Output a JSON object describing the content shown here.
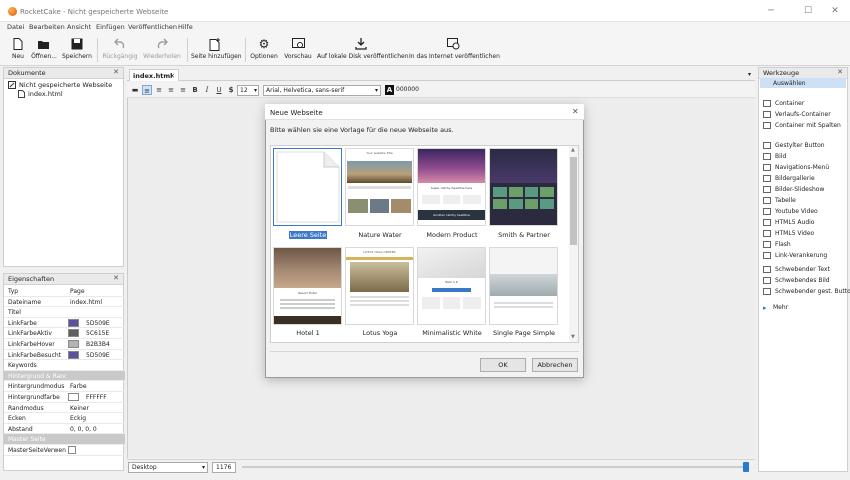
{
  "window": {
    "title": "RocketCake - Nicht gespeicherte Webseite",
    "minimize": "─",
    "maximize": "☐",
    "close": "✕"
  },
  "menu": [
    "Datei",
    "Bearbeiten",
    "Ansicht",
    "Einfügen",
    "Veröffentlichen",
    "Hilfe"
  ],
  "toolbar": {
    "neu": "Neu",
    "oeffnen": "Öffnen...",
    "speichern": "Speichern",
    "rueckgaengig": "Rückgängig",
    "wiederholen": "Wiederholen",
    "seite": "Seite hinzufügen",
    "optionen": "Optionen",
    "vorschau": "Vorschau",
    "lokal": "Auf lokale Disk veröffentlichen",
    "internet": "In das Internet veröffentlichen"
  },
  "documents": {
    "title": "Dokumente",
    "close": "✕",
    "root": "Nicht gespeicherte Webseite",
    "page": "index.html"
  },
  "properties": {
    "title": "Eigenschaften",
    "close": "✕",
    "rows": [
      {
        "k": "Typ",
        "v": "Page"
      },
      {
        "k": "Dateiname",
        "v": "index.html"
      },
      {
        "k": "Titel",
        "v": ""
      },
      {
        "k": "LinkFarbe",
        "v": "5D509E",
        "color": "#5D509E"
      },
      {
        "k": "LinkFarbeAktiv",
        "v": "5C615E",
        "color": "#5C615E"
      },
      {
        "k": "LinkFarbeHover",
        "v": "B2B3B4",
        "color": "#B2B3B4"
      },
      {
        "k": "LinkFarbeBesucht",
        "v": "5D509E",
        "color": "#5D509E"
      },
      {
        "k": "Keywords",
        "v": ""
      },
      {
        "k": "Hintergrund & Rand",
        "sec": true
      },
      {
        "k": "Hintergrundmodus",
        "v": "Farbe"
      },
      {
        "k": "Hintergrundfarbe",
        "v": "FFFFFF",
        "color": "#FFFFFF"
      },
      {
        "k": "Randmodus",
        "v": "Keiner"
      },
      {
        "k": "Ecken",
        "v": "Eckig"
      },
      {
        "k": "Abstand",
        "v": "0, 0, 0, 0"
      },
      {
        "k": "Master Seite",
        "sec": true
      },
      {
        "k": "MasterSeiteVerwenden",
        "v": "",
        "check": true
      }
    ]
  },
  "editor": {
    "tab": "index.html",
    "font": "Arial, Helvetica, sans-serif",
    "size": "12",
    "color_label": "A",
    "color": "000000",
    "dollar": "$"
  },
  "statusbar": {
    "view": "Desktop",
    "width": "1176"
  },
  "tools": {
    "title": "Werkzeuge",
    "close": "✕",
    "items": [
      "Auswählen",
      "Container",
      "Verlaufs-Container",
      "Container mit Spalten",
      "Gestylter Button",
      "Bild",
      "Navigations-Menü",
      "Bildergallerie",
      "Bilder-Slideshow",
      "Tabelle",
      "Youtube Video",
      "HTML5 Audio",
      "HTML5 Video",
      "Flash",
      "Link-Verankerung",
      "Schwebender Text",
      "Schwebendes Bild",
      "Schwebender gest. Button",
      "Mehr"
    ]
  },
  "dialog": {
    "title": "Neue Webseite",
    "close": "✕",
    "prompt": "Bitte wählen sie eine Vorlage für die neue Webseite aus.",
    "templates": [
      "Leere Seite",
      "Nature Water",
      "Modern Product",
      "Smith & Partner",
      "Hotel 1",
      "Lotus Yoga",
      "Minimalistic White",
      "Single Page Simple"
    ],
    "thumb_text": {
      "nature": "Your website Title",
      "modern": "Super catchy headline here",
      "modern_btn": "Another catchy headline",
      "smith": "Smith & Partner",
      "hotel": "Resort Hotel",
      "yoga": "LOTUS YOGA CENTER",
      "minimal": "Item 1 $"
    },
    "ok": "OK",
    "cancel": "Abbrechen"
  }
}
